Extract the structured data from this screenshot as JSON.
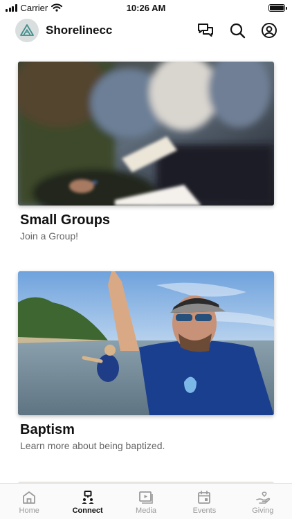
{
  "status_bar": {
    "carrier": "Carrier",
    "time": "10:26 AM",
    "battery_level": 1.0
  },
  "header": {
    "app_name": "Shorelinecc",
    "icons": [
      "logo-icon",
      "chat-icon",
      "search-icon",
      "profile-icon"
    ]
  },
  "cards": [
    {
      "title": "Small Groups",
      "subtitle": "Join a Group!",
      "image": "small-groups-photo"
    },
    {
      "title": "Baptism",
      "subtitle": "Learn more about being baptized.",
      "image": "baptism-photo"
    }
  ],
  "tab_bar": {
    "tabs": [
      {
        "label": "Home",
        "icon": "home-icon",
        "active": false
      },
      {
        "label": "Connect",
        "icon": "connect-icon",
        "active": true
      },
      {
        "label": "Media",
        "icon": "media-icon",
        "active": false
      },
      {
        "label": "Events",
        "icon": "calendar-icon",
        "active": false
      },
      {
        "label": "Giving",
        "icon": "giving-icon",
        "active": false
      }
    ]
  },
  "colors": {
    "active_tab": "#111111",
    "inactive_tab": "#9a9a9a",
    "logo_bg": "#d9dedf",
    "logo_accent": "#3f8d8a"
  }
}
